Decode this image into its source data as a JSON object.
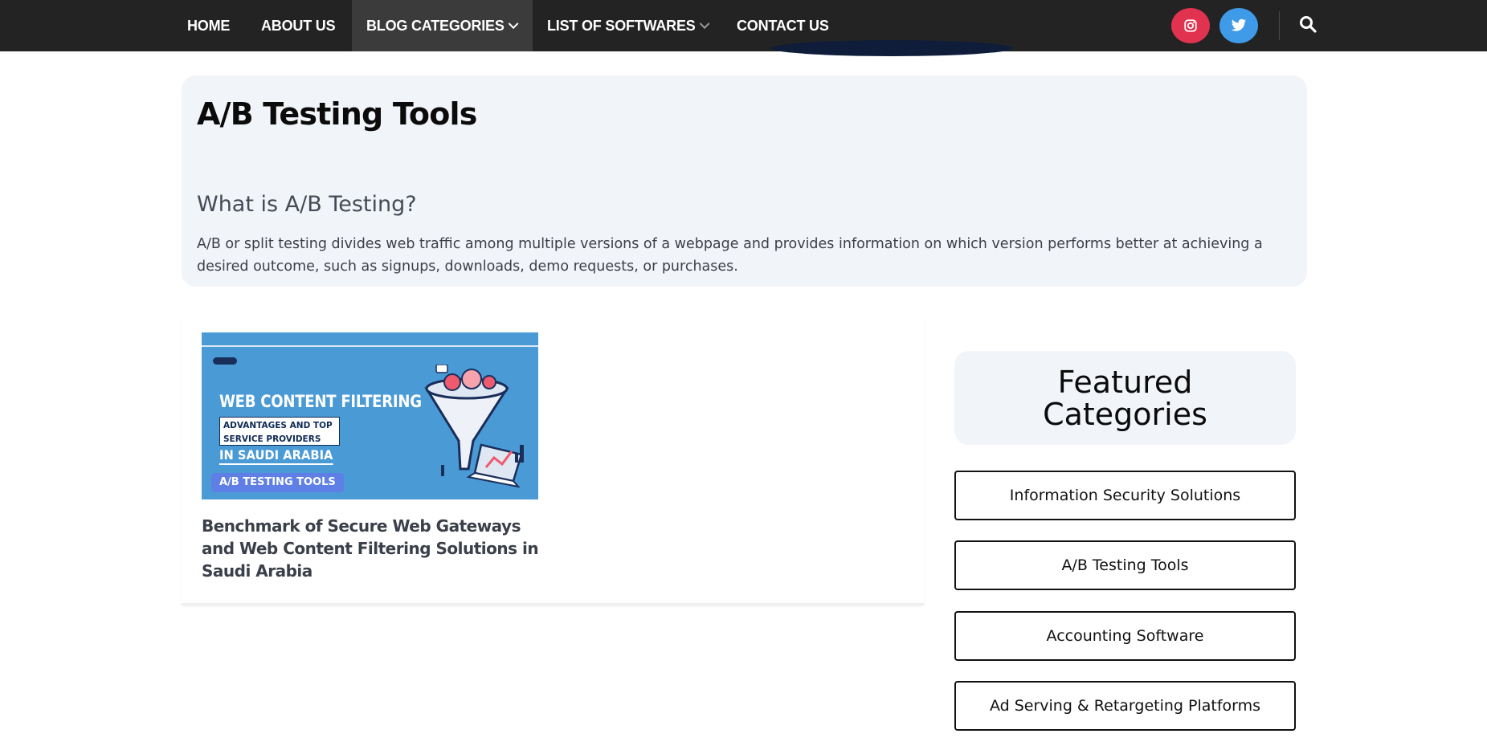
{
  "nav": {
    "items": [
      {
        "label": "HOME"
      },
      {
        "label": "ABOUT US"
      },
      {
        "label": "BLOG CATEGORIES"
      },
      {
        "label": "LIST OF SOFTWARES"
      },
      {
        "label": "CONTACT US"
      }
    ],
    "icons": {
      "instagram": "instagram-icon",
      "twitter": "twitter-icon",
      "search": "search-icon"
    },
    "colors": {
      "bar": "#232323",
      "active": "#3b3b3b",
      "instagram": "#e1334f",
      "twitter": "#3f9be8"
    }
  },
  "hero": {
    "title": "A/B Testing Tools",
    "subtitle": "What is A/B Testing?",
    "description": "A/B or split testing divides web traffic among multiple versions of a webpage and provides information on which version performs better at achieving a desired outcome, such as signups, downloads, demo requests, or purchases."
  },
  "post": {
    "thumbnail": {
      "headline": "WEB CONTENT FILTERING",
      "subtext_line1": "ADVANTAGES AND TOP",
      "subtext_line2": "SERVICE PROVIDERS",
      "location": "IN SAUDI ARABIA",
      "category_tag": "A/B TESTING TOOLS"
    },
    "title": "Benchmark of Secure Web Gateways and Web Content Filtering Solutions in Saudi Arabia"
  },
  "sidebar": {
    "heading": "Featured Categories",
    "categories": [
      {
        "label": "Information Security Solutions"
      },
      {
        "label": "A/B Testing Tools"
      },
      {
        "label": "Accounting Software"
      },
      {
        "label": "Ad Serving & Retargeting Platforms"
      }
    ]
  }
}
